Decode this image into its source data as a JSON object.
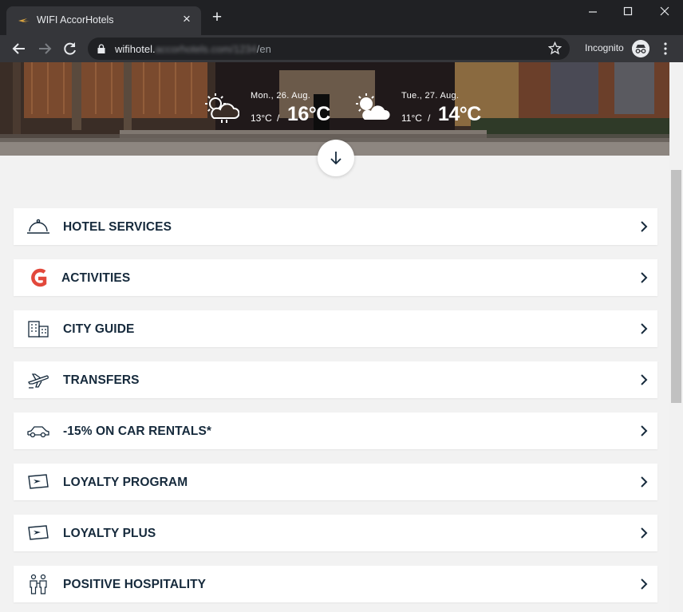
{
  "browser": {
    "tab_title": "WIFI AccorHotels",
    "url_prefix": "wifihotel.",
    "url_blurred": "accorhotels.com/1234",
    "url_suffix": "/en",
    "incognito_label": "Incognito"
  },
  "weather": [
    {
      "date": "Mon., 26. Aug.",
      "min": "13°C",
      "sep": "/",
      "max": "16°C",
      "icon": "sun-cloud-rain-icon"
    },
    {
      "date": "Tue., 27. Aug.",
      "min": "11°C",
      "sep": "/",
      "max": "14°C",
      "icon": "sun-cloud-icon"
    }
  ],
  "menu": {
    "items": [
      {
        "label": "HOTEL SERVICES",
        "icon": "service-bell-icon"
      },
      {
        "label": "ACTIVITIES",
        "icon": "activities-logo-icon"
      },
      {
        "label": "CITY GUIDE",
        "icon": "city-buildings-icon"
      },
      {
        "label": "TRANSFERS",
        "icon": "airplane-icon"
      },
      {
        "label": "-15% ON CAR RENTALS*",
        "icon": "car-icon"
      },
      {
        "label": "LOYALTY PROGRAM",
        "icon": "loyalty-card-icon"
      },
      {
        "label": "LOYALTY PLUS",
        "icon": "loyalty-card-icon"
      },
      {
        "label": "POSITIVE HOSPITALITY",
        "icon": "people-icon"
      }
    ]
  },
  "colors": {
    "label": "#162a3c",
    "activities_accent": "#e2483b",
    "chrome_dark": "#202124",
    "chrome_toolbar": "#35363a"
  }
}
